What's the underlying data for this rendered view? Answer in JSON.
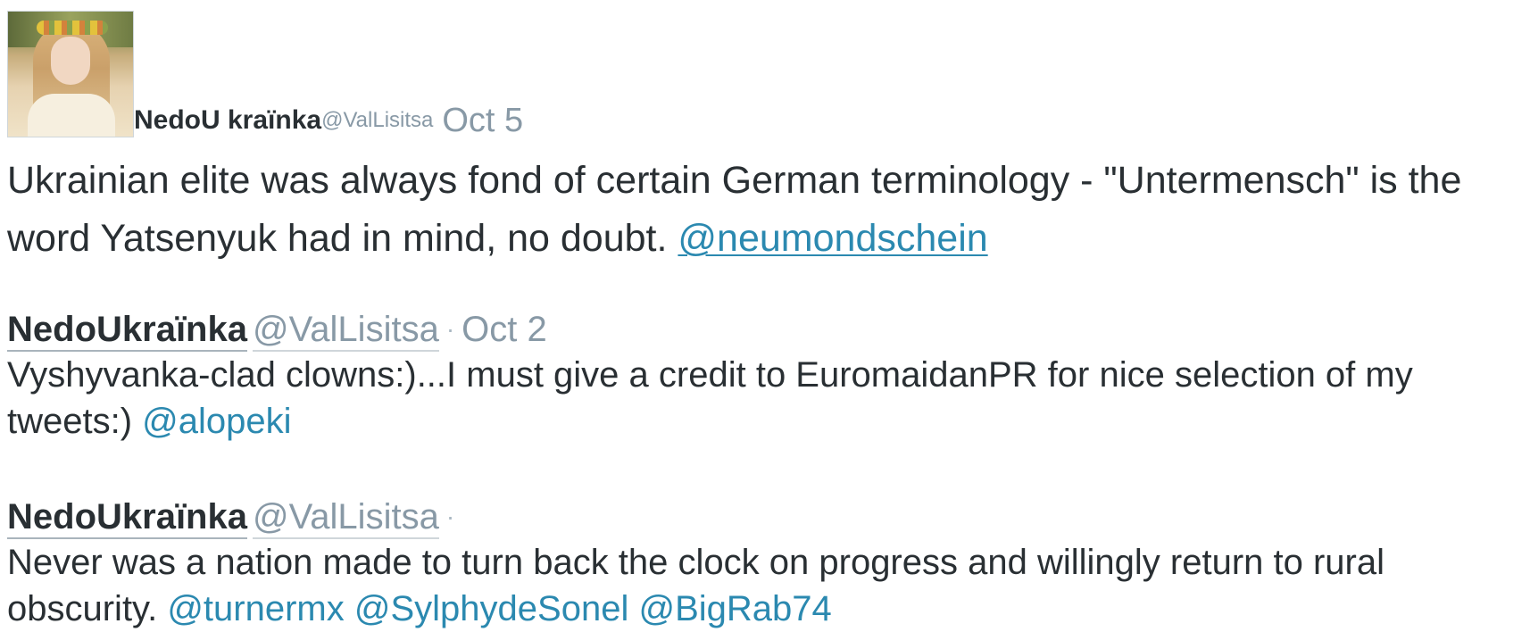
{
  "tweets": [
    {
      "name": "NedoU kraïnka",
      "handle": "@ValLisitsa",
      "date": "Oct 5",
      "text": "Ukrainian elite was always fond of certain German terminology - \"Untermensch\" is the word Yatsenyuk had in mind, no doubt.",
      "mentions": [
        "@neumondschein"
      ]
    },
    {
      "name": "NedoUkraïnka",
      "handle": "@ValLisitsa",
      "separator": "·",
      "date": "Oct 2",
      "text": "Vyshyvanka-clad clowns:)...I must give a credit to EuromaidanPR for nice selection of my tweets:)",
      "mentions": [
        "@alopeki"
      ]
    },
    {
      "name": "NedoUkraïnka",
      "handle": "@ValLisitsa",
      "separator": "·",
      "text": "Never was a nation made to turn back the clock on progress and willingly return to rural obscurity.",
      "mentions": [
        "@turnermx",
        "@SylphydeSonel",
        "@BigRab74"
      ]
    }
  ],
  "colors": {
    "text": "#292f33",
    "muted": "#8899a6",
    "link": "#2b89b0"
  }
}
